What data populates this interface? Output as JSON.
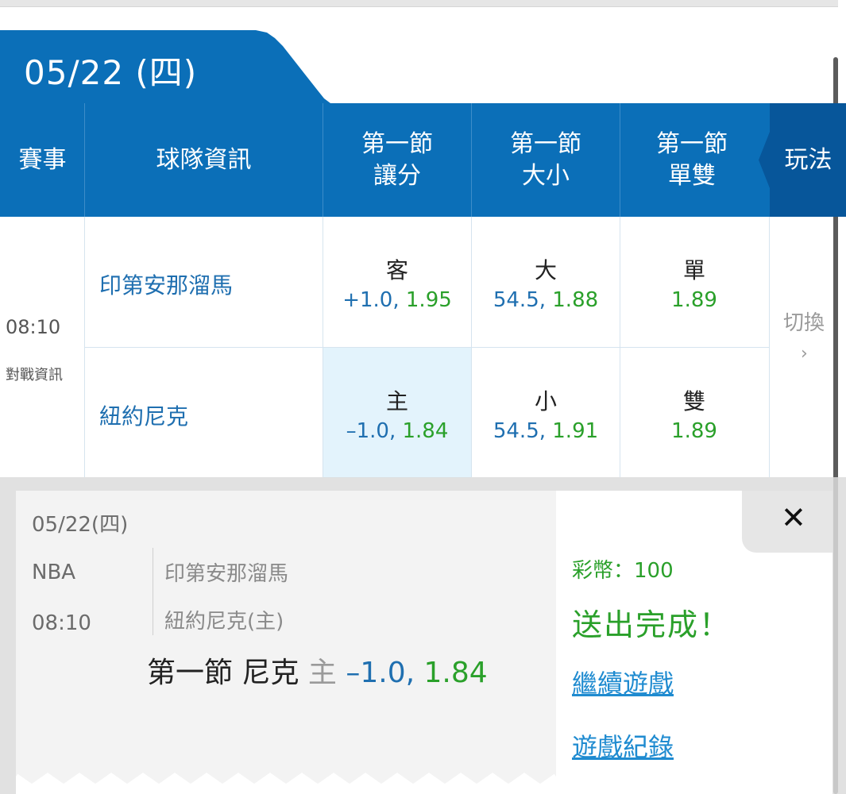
{
  "date_tab": "05/22 (四)",
  "headers": {
    "event": "賽事",
    "team_info": "球隊資訊",
    "q1_handicap": "第一節\n讓分",
    "q1_total": "第一節\n大小",
    "q1_oddeven": "第一節\n單雙",
    "play_type": "玩法"
  },
  "match": {
    "time": "08:10",
    "vs_info": "對戰資訊",
    "away_team": "印第安那溜馬",
    "home_team": "紐約尼克",
    "switch_label": "切換",
    "switch_arrow": "›"
  },
  "odds": {
    "handicap": {
      "away_label": "客",
      "away_line": "+1.0,",
      "away_odds": "1.95",
      "home_label": "主",
      "home_line": "–1.0,",
      "home_odds": "1.84"
    },
    "total": {
      "over_label": "大",
      "over_line": "54.5,",
      "over_odds": "1.88",
      "under_label": "小",
      "under_line": "54.5,",
      "under_odds": "1.91"
    },
    "oddeven": {
      "odd_label": "單",
      "odd_odds": "1.89",
      "even_label": "雙",
      "even_odds": "1.89"
    }
  },
  "popup": {
    "date": "05/22(四)",
    "league": "NBA",
    "time": "08:10",
    "team1": "印第安那溜馬",
    "team2": "紐約尼克(主)",
    "bet_prefix": "第一節 尼克",
    "bet_side": "主",
    "bet_line": "–1.0,",
    "bet_odds": "1.84",
    "credit": "彩幣：100",
    "done": "送出完成！",
    "continue": "繼續遊戲",
    "history": "遊戲紀錄",
    "close": "✕"
  },
  "colors": {
    "brand_blue": "#0b6fb8",
    "odds_green": "#2aa02a",
    "line_blue": "#1f6fb0",
    "selected_bg": "#e3f3fc"
  }
}
